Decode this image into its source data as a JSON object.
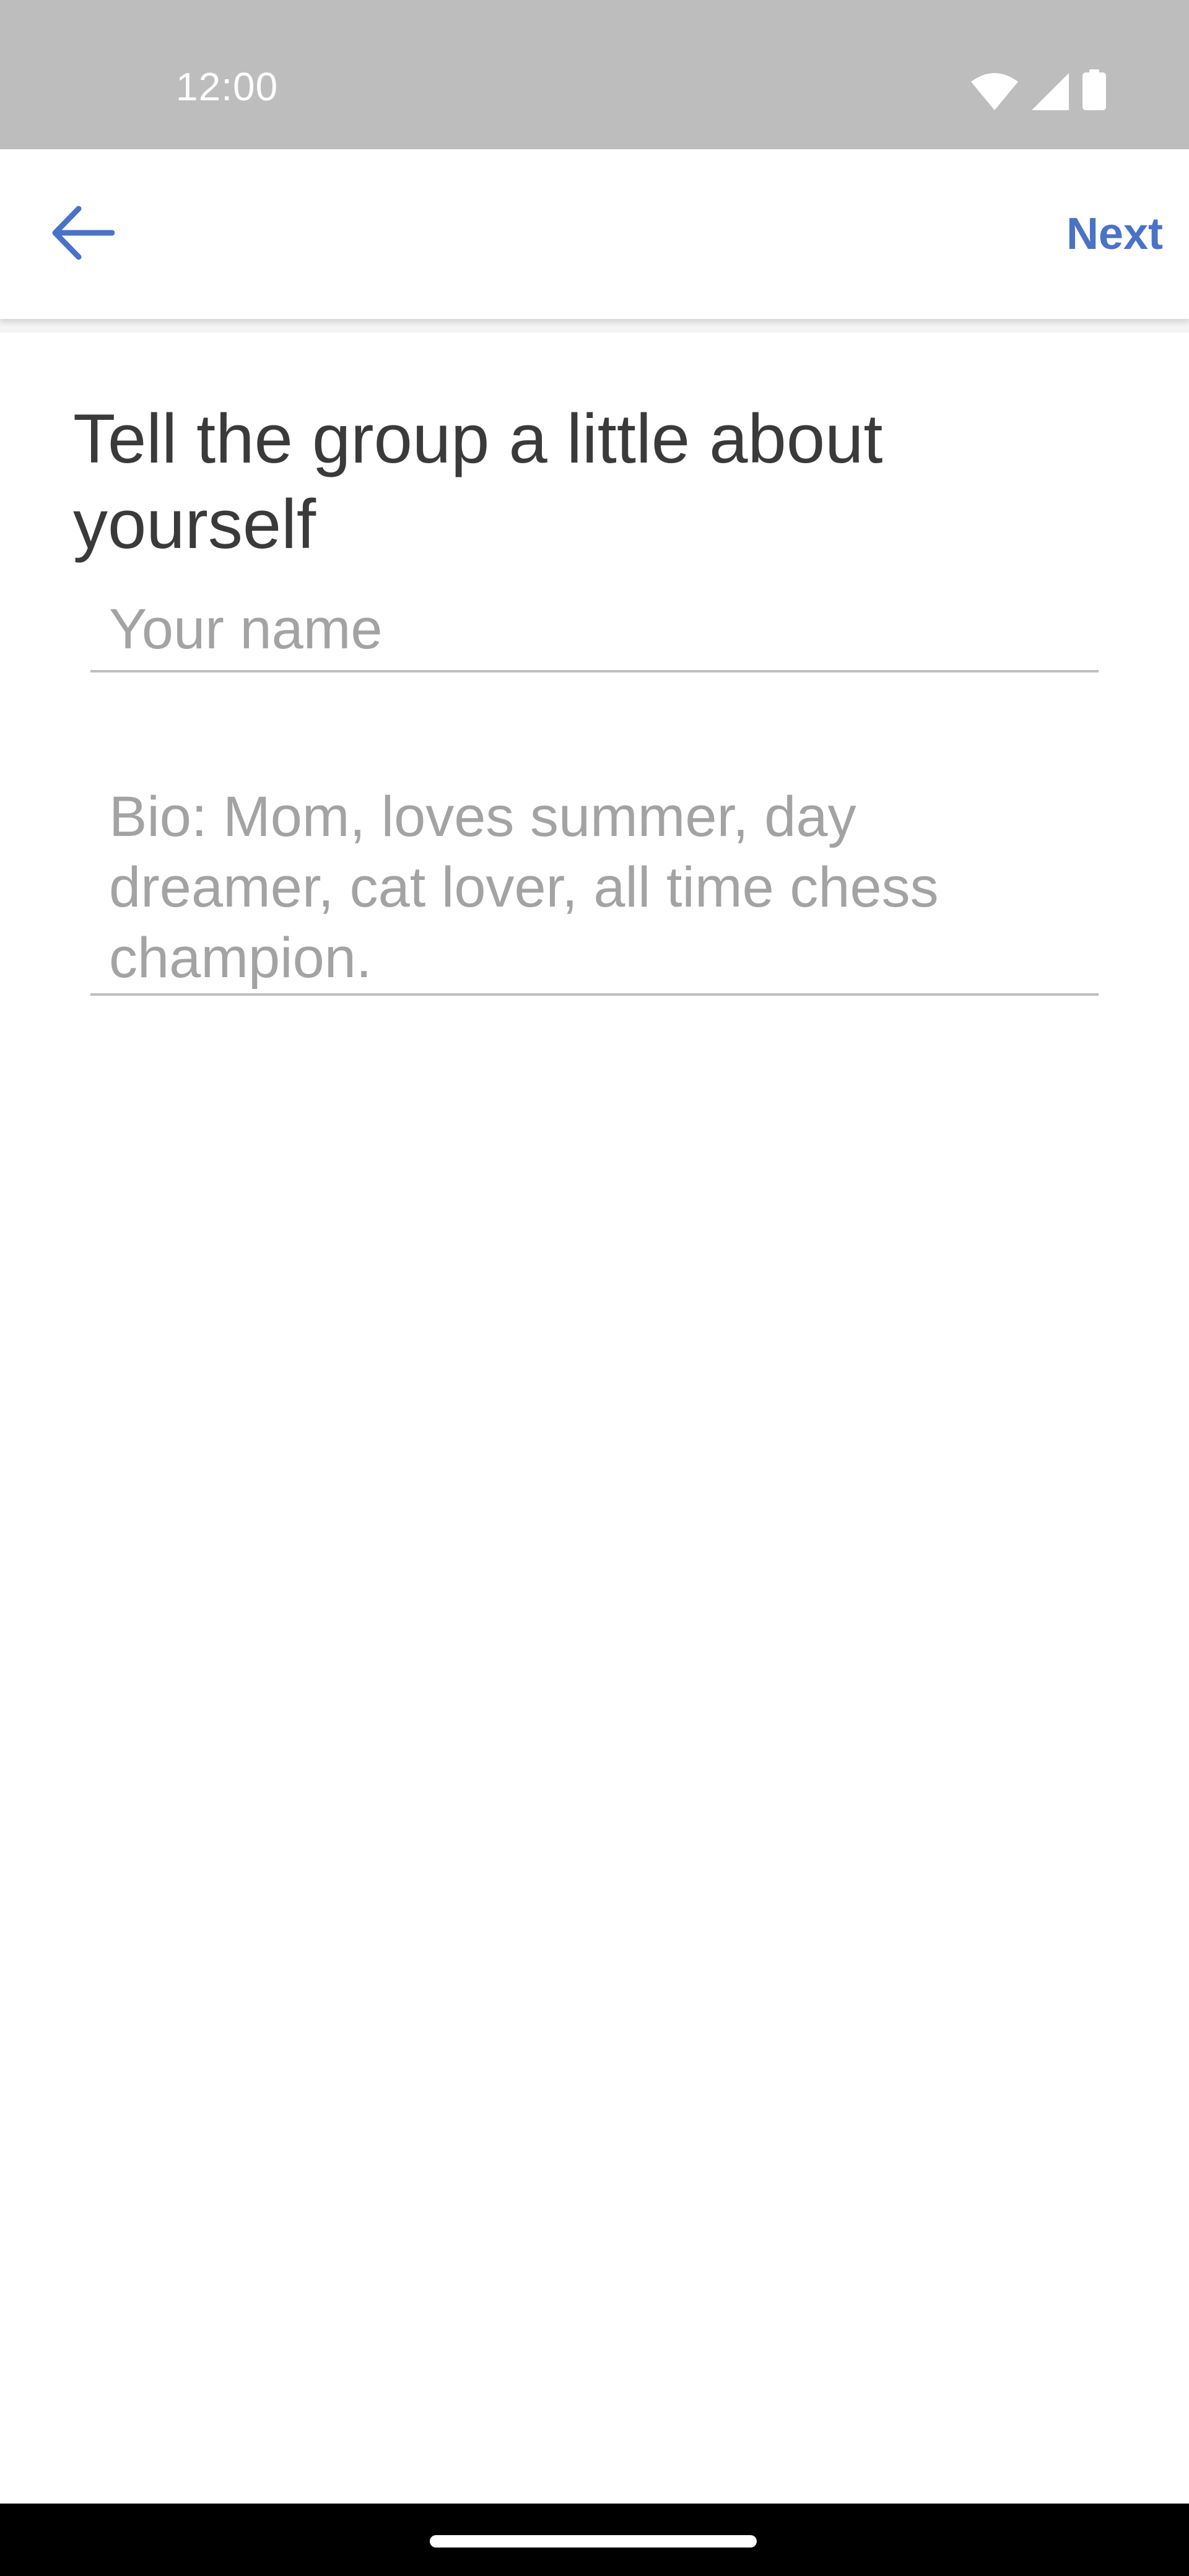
{
  "status_bar": {
    "time": "12:00",
    "icons": [
      "wifi-icon",
      "cellular-signal-icon",
      "battery-icon"
    ]
  },
  "app_bar": {
    "back_icon": "arrow-back-icon",
    "next_label": "Next"
  },
  "form": {
    "title": "Tell the group a little about yourself",
    "name": {
      "placeholder": "Your name",
      "value": ""
    },
    "bio": {
      "placeholder": "Bio: Mom, loves summer, day dreamer, cat lover, all time chess champion.",
      "value": ""
    }
  },
  "colors": {
    "accent": "#4a72c6",
    "status_bar_bg": "#bdbdbd",
    "title_text": "#3a3a3a",
    "placeholder_text": "#a3a3a3",
    "field_underline": "#bfbfbf",
    "nav_bar_bg": "#000000"
  }
}
